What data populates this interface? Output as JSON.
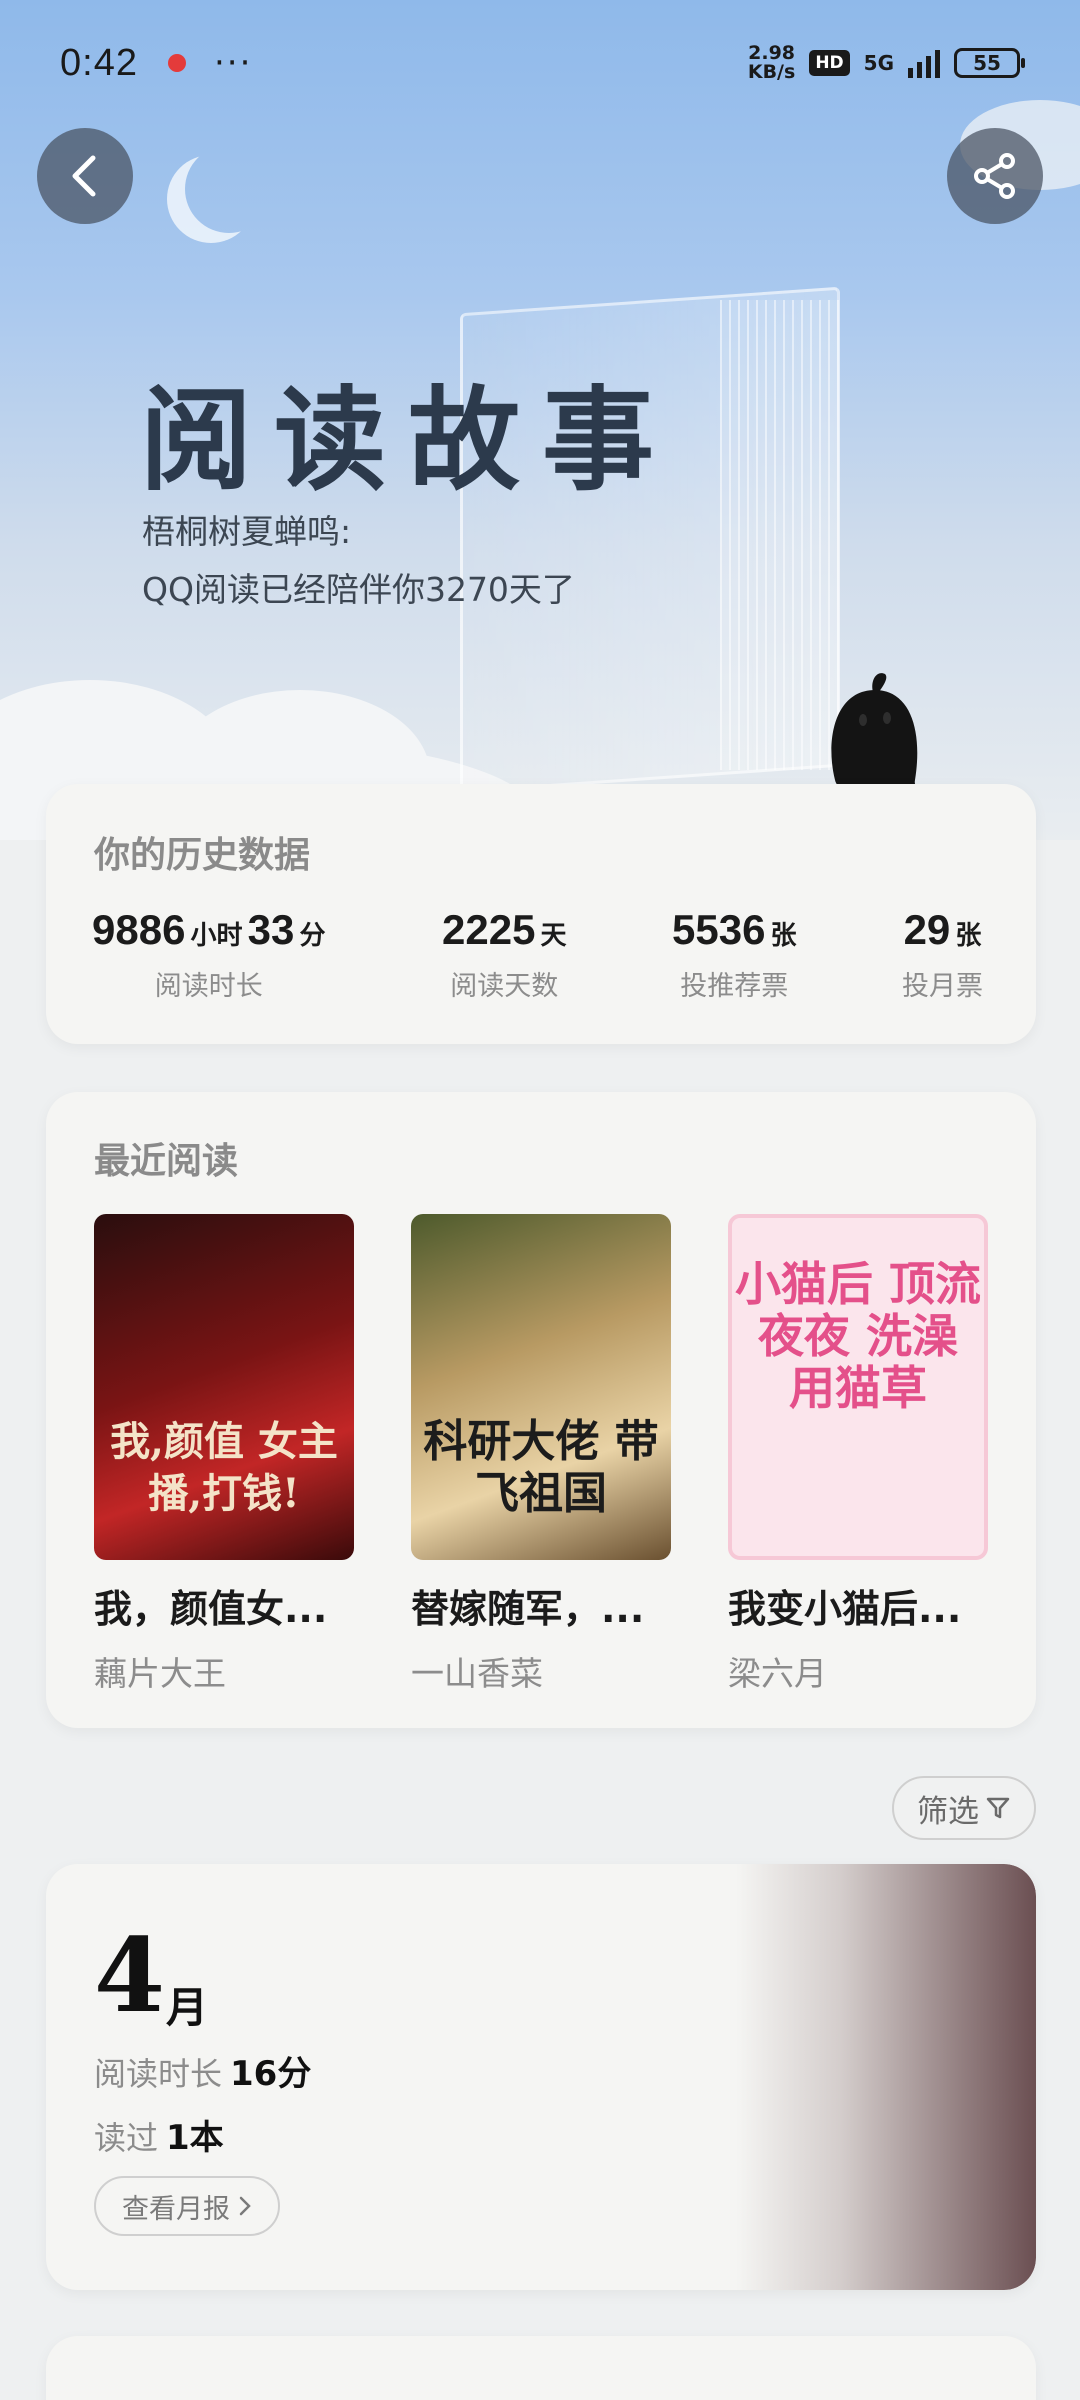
{
  "status_bar": {
    "time": "0:42",
    "more": "···",
    "net_speed_top": "2.98",
    "net_speed_bottom": "KB/s",
    "hd": "HD",
    "network": "5G",
    "battery": "55"
  },
  "hero": {
    "title": "阅读故事",
    "subtitle_line1": "梧桐树夏蝉鸣:",
    "subtitle_line2": "QQ阅读已经陪伴你3270天了"
  },
  "history": {
    "title": "你的历史数据",
    "stats": [
      {
        "value_a": "9886",
        "unit_a": "小时",
        "value_b": "33",
        "unit_b": "分",
        "label": "阅读时长"
      },
      {
        "value_a": "2225",
        "unit_a": "天",
        "label": "阅读天数"
      },
      {
        "value_a": "5536",
        "unit_a": "张",
        "label": "投推荐票"
      },
      {
        "value_a": "29",
        "unit_a": "张",
        "label": "投月票"
      }
    ]
  },
  "recent": {
    "title": "最近阅读",
    "books": [
      {
        "title": "我，颜值女...",
        "author": "藕片大王",
        "cover_text": "我,颜值 女主播,打钱!"
      },
      {
        "title": "替嫁随军，...",
        "author": "一山香菜",
        "cover_text": "科研大佬 带飞祖国"
      },
      {
        "title": "我变小猫后...",
        "author": "梁六月",
        "cover_text": "小猫后 顶流夜夜 洗澡 用猫草"
      }
    ]
  },
  "filter_label": "筛选",
  "month_card": {
    "month": "4",
    "month_unit": "月",
    "duration_label": "阅读时长",
    "duration_value": "16分",
    "read_label": "读过",
    "read_value": "1本",
    "report_button": "查看月报"
  },
  "colors": {
    "accent_dark": "#2c3a4c",
    "card_bg": "#f5f5f3",
    "muted_text": "#8c8c8c"
  }
}
